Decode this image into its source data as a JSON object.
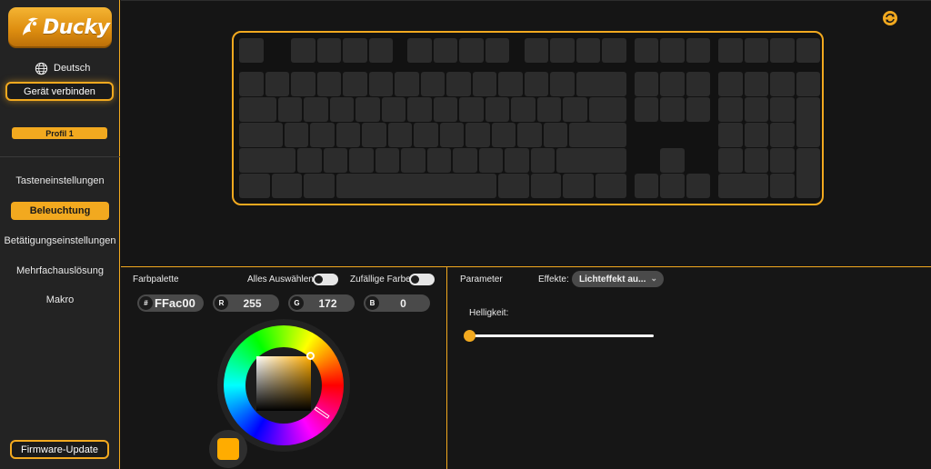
{
  "app": {
    "brand": "Ducky"
  },
  "sidebar": {
    "language": "Deutsch",
    "connect_label": "Gerät verbinden",
    "profile": "Profil 1",
    "items": [
      {
        "label": "Tasteneinstellungen",
        "active": false
      },
      {
        "label": "Beleuchtung",
        "active": true
      },
      {
        "label": "Betätigungseinstellungen",
        "active": false
      },
      {
        "label": "Mehrfachauslösung",
        "active": false
      },
      {
        "label": "Makro",
        "active": false
      }
    ],
    "firmware_label": "Firmware-Update"
  },
  "palette": {
    "title": "Farbpalette",
    "select_all_label": "Alles Auswählen",
    "select_all_on": false,
    "random_color_label": "Zufällige Farbe",
    "random_color_on": false,
    "hex_tag": "#",
    "hex_value": "FFac00",
    "r_tag": "R",
    "r_value": "255",
    "g_tag": "G",
    "g_value": "172",
    "b_tag": "B",
    "b_value": "0",
    "current_color": "#ffac00"
  },
  "parameter": {
    "title": "Parameter",
    "effects_label": "Effekte:",
    "effect_value": "Lichteffekt au...",
    "brightness_label": "Helligkeit:",
    "brightness_value": 0
  },
  "colors": {
    "accent": "#f2a91f",
    "panel": "#232323",
    "background": "#161616",
    "key": "#2c2c2c"
  },
  "icons": {
    "language": "globe-icon",
    "refresh": "refresh-icon",
    "select_chevron": "chevron-down-icon",
    "logo": "duck-logo-icon"
  }
}
